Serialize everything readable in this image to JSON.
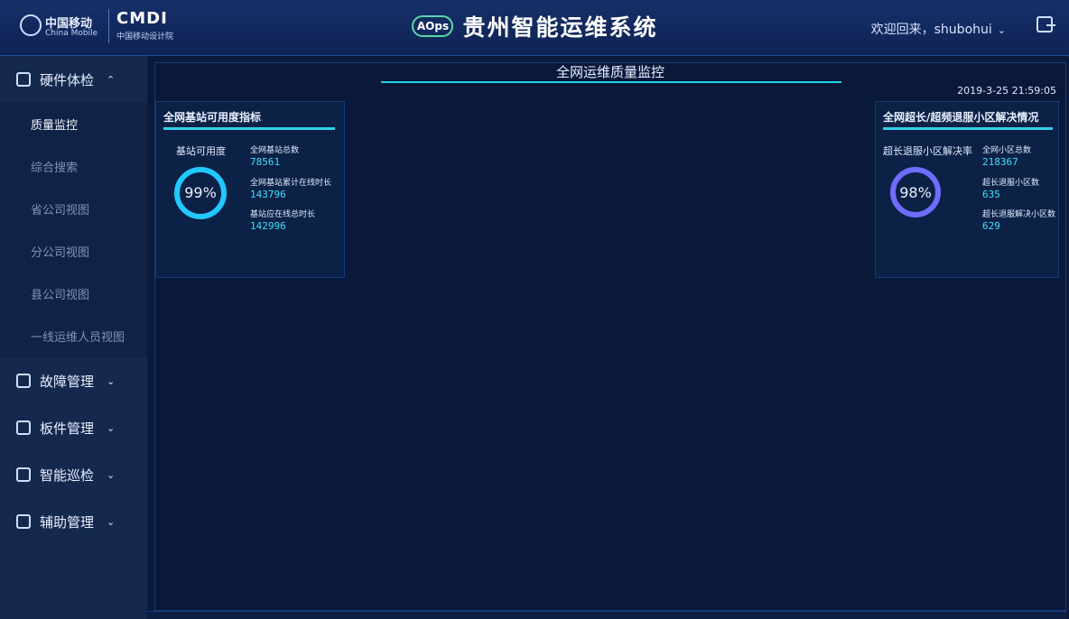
{
  "header": {
    "cm_title": "中国移动",
    "cm_sub": "China Mobile",
    "cmdi_title": "CMDI",
    "cmdi_sub": "中国移动设计院",
    "aiops": "AOps",
    "title": "贵州智能运维系统",
    "welcome": "欢迎回来，shubohui"
  },
  "sidebar": {
    "items": [
      {
        "label": "硬件体检",
        "expanded": true
      },
      {
        "label": "故障管理"
      },
      {
        "label": "板件管理"
      },
      {
        "label": "智能巡检"
      },
      {
        "label": "辅助管理"
      }
    ],
    "subitems": [
      "质量监控",
      "综合搜索",
      "省公司视图",
      "分公司视图",
      "县公司视图",
      "一线运维人员视图"
    ]
  },
  "main": {
    "title": "全网运维质量监控",
    "datetime": "2019-3-25 21:59:05"
  },
  "left": {
    "availability": {
      "title": "全网基站可用度指标",
      "ring_label": "基站可用度",
      "percent": "99%",
      "total_label": "全网基站总数",
      "total_value": "78561",
      "online_label": "全网基站累计在线时长",
      "online_value": "143796",
      "should_label": "基站应在线总时长",
      "should_value": "142996"
    }
  },
  "right": {
    "ultra": {
      "title": "全网超长/超频退服小区解决情况",
      "ring_label": "超长退服小区解决率",
      "percent": "98%",
      "total_label": "全网小区总数",
      "total_value": "218367",
      "cells_label": "超长退服小区数",
      "cells_value": "635",
      "solved_label": "超长退服解决小区数",
      "solved_value": "629"
    }
  }
}
